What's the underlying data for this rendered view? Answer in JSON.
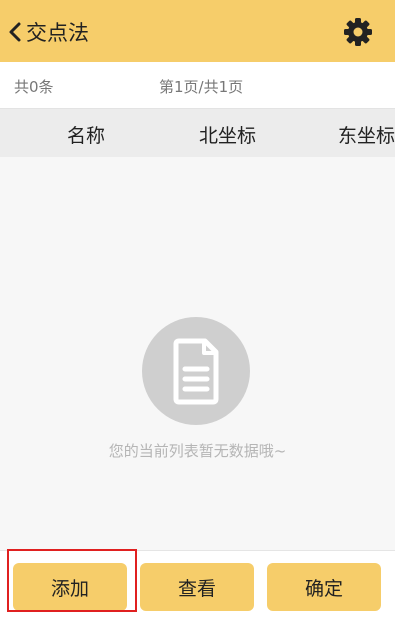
{
  "header": {
    "title": "交点法",
    "back_icon": "chevron-left-icon",
    "settings_icon": "gear-icon"
  },
  "info_bar": {
    "count_text": "共0条",
    "page_text": "第1页/共1页"
  },
  "table": {
    "columns": [
      "名称",
      "北坐标",
      "东坐标"
    ]
  },
  "empty_state": {
    "icon": "document-icon",
    "message": "您的当前列表暂无数据哦~"
  },
  "footer": {
    "add_label": "添加",
    "view_label": "查看",
    "confirm_label": "确定"
  },
  "colors": {
    "accent": "#f6cd6a",
    "highlight": "#e02020"
  }
}
